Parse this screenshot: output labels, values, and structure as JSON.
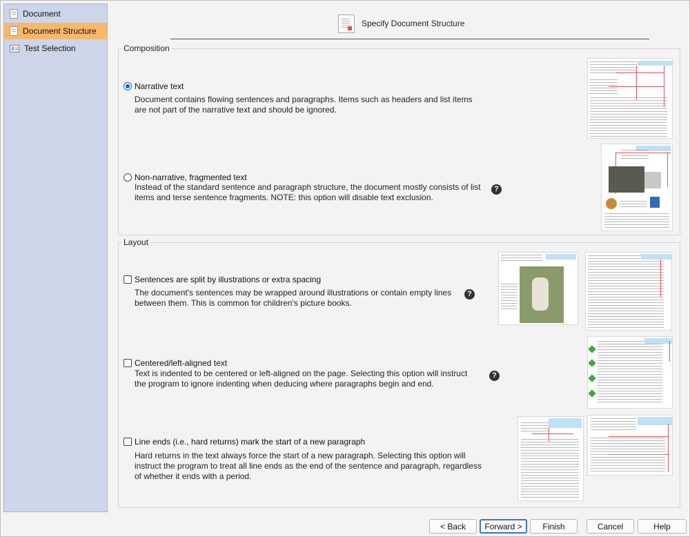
{
  "sidebar": {
    "items": [
      {
        "label": "Document",
        "icon": "document-icon",
        "active": false
      },
      {
        "label": "Document Structure",
        "icon": "document-icon",
        "active": true
      },
      {
        "label": "Test Selection",
        "icon": "test-selection-icon",
        "active": false
      }
    ]
  },
  "header": {
    "title": "Specify Document Structure",
    "icon": "document-structure-icon"
  },
  "composition": {
    "label": "Composition",
    "narrative": {
      "label": "Narrative text",
      "checked": true,
      "desc_1": "Document contains flowing sentences and paragraphs. Items such as headers and list items",
      "desc_2": "are not part of the narrative text and should be ignored."
    },
    "nonnarrative": {
      "label": "Non-narrative, fragmented text",
      "checked": false,
      "desc_1": "Instead of the standard sentence and paragraph structure, the document mostly consists of list",
      "desc_2": "items and terse sentence fragments. NOTE: this option will disable text exclusion."
    }
  },
  "layout": {
    "label": "Layout",
    "split": {
      "label": "Sentences are split by illustrations or extra spacing",
      "checked": false,
      "desc_1": "The document's sentences may be wrapped around illustrations or contain empty lines",
      "desc_2": "between them. This is common for children's picture books."
    },
    "centered": {
      "label": "Centered/left-aligned text",
      "checked": false,
      "desc_1": "Text is indented to be centered or left-aligned on the page. Selecting this option will instruct",
      "desc_2": "the program to ignore indenting when deducing where paragraphs begin and end."
    },
    "lineends": {
      "label": "Line ends (i.e., hard returns) mark the start of a new paragraph",
      "checked": false,
      "desc_1": "Hard returns in the text always force the start of a new paragraph. Selecting this option will",
      "desc_2": "instruct the program to treat all line ends as the end of the sentence and paragraph, regardless",
      "desc_3": "of whether it ends with a period."
    }
  },
  "help_glyph": "?",
  "buttons": {
    "back": "< Back",
    "forward": "Forward >",
    "finish": "Finish",
    "cancel": "Cancel",
    "help": "Help"
  },
  "colors": {
    "sidebar_bg": "#cdd6e8",
    "active_item": "#f8b86b",
    "radio_accent": "#1a5fb4",
    "default_button_border": "#3b73c4"
  }
}
